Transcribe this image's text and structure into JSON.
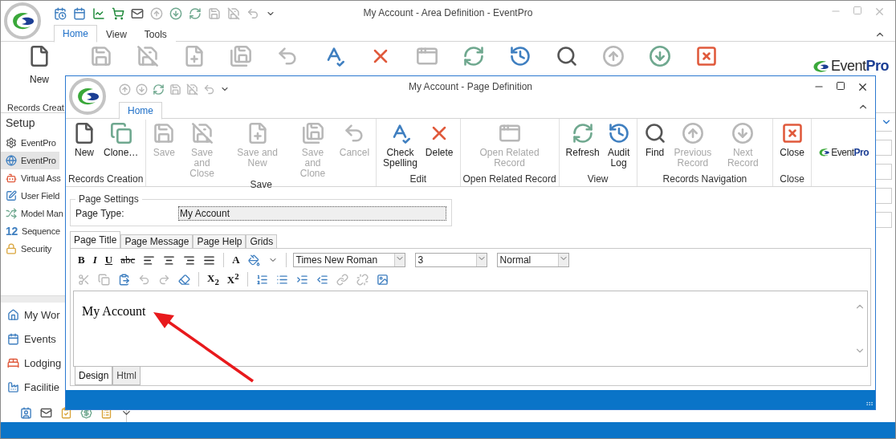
{
  "main_window": {
    "title": "My Account - Area Definition - EventPro",
    "quick_access": [
      {
        "kind": "schedule",
        "disabled": false
      },
      {
        "kind": "calendar",
        "disabled": false
      },
      {
        "kind": "chart",
        "disabled": false
      },
      {
        "kind": "cart",
        "disabled": false
      },
      {
        "kind": "mail",
        "disabled": false
      },
      {
        "kind": "up",
        "disabled": true
      },
      {
        "kind": "down",
        "disabled": false
      },
      {
        "kind": "refresh",
        "disabled": false
      },
      {
        "kind": "save",
        "disabled": true
      },
      {
        "kind": "saveclose",
        "disabled": true
      },
      {
        "kind": "undo",
        "disabled": true
      },
      {
        "kind": "more",
        "disabled": false
      }
    ],
    "tabs": [
      {
        "label": "Home",
        "selected": true
      },
      {
        "label": "View",
        "selected": false
      },
      {
        "label": "Tools",
        "selected": false
      }
    ],
    "ribbon_buttons": [
      {
        "kind": "new",
        "label": "New",
        "disabled": false
      },
      {
        "kind": "save",
        "disabled": true
      },
      {
        "kind": "saveclose",
        "disabled": true
      },
      {
        "kind": "savenew",
        "disabled": true
      },
      {
        "kind": "saveclone",
        "disabled": true
      },
      {
        "kind": "undo",
        "disabled": true
      },
      {
        "kind": "spell",
        "disabled": false
      },
      {
        "kind": "delete",
        "disabled": false
      },
      {
        "kind": "window",
        "disabled": true
      },
      {
        "kind": "refresh",
        "disabled": false
      },
      {
        "kind": "audit",
        "disabled": false
      },
      {
        "kind": "find",
        "disabled": false
      },
      {
        "kind": "up",
        "disabled": true
      },
      {
        "kind": "down",
        "disabled": false
      },
      {
        "kind": "close",
        "disabled": false
      }
    ],
    "group_label": "Records Creat",
    "logo": {
      "main": "Event",
      "accent": "Pro"
    },
    "nav": {
      "header": "Setup",
      "items": [
        {
          "label": "EventPro",
          "selected": false
        },
        {
          "label": "EventPro",
          "selected": true
        },
        {
          "label": "Virtual Ass",
          "selected": false
        },
        {
          "label": "User Field",
          "selected": false
        },
        {
          "label": "Model Man",
          "selected": false
        },
        {
          "glyph": "12",
          "label": "Sequence",
          "selected": false
        },
        {
          "label": "Security",
          "selected": false
        }
      ]
    },
    "modules": [
      {
        "label": "My Wor"
      },
      {
        "label": "Events"
      },
      {
        "label": "Lodging"
      },
      {
        "label": "Facilitie"
      }
    ]
  },
  "dialog": {
    "title": "My Account - Page Definition",
    "quick_access": [
      {
        "kind": "up",
        "disabled": true
      },
      {
        "kind": "down",
        "disabled": true
      },
      {
        "kind": "refresh",
        "disabled": false
      },
      {
        "kind": "save",
        "disabled": true
      },
      {
        "kind": "saveclose",
        "disabled": true
      },
      {
        "kind": "undo",
        "disabled": true
      },
      {
        "kind": "more",
        "disabled": false
      }
    ],
    "tabs": [
      {
        "label": "Home",
        "selected": true
      }
    ],
    "groups": [
      {
        "label": "Records Creation",
        "buttons": [
          {
            "kind": "new",
            "label": "New",
            "disabled": false
          },
          {
            "kind": "clone",
            "label": "Clone…",
            "disabled": false
          }
        ]
      },
      {
        "label": "Save",
        "buttons": [
          {
            "kind": "save",
            "label": "Save",
            "disabled": true
          },
          {
            "kind": "saveclose",
            "label": "Save and\nClose",
            "disabled": true
          },
          {
            "kind": "savenew",
            "label": "Save and New",
            "disabled": true
          },
          {
            "kind": "saveclone",
            "label": "Save and\nClone",
            "disabled": true
          },
          {
            "kind": "undo",
            "label": "Cancel",
            "disabled": true
          }
        ]
      },
      {
        "label": "Edit",
        "buttons": [
          {
            "kind": "spell",
            "label": "Check\nSpelling",
            "disabled": false
          },
          {
            "kind": "delete",
            "label": "Delete",
            "disabled": false
          }
        ]
      },
      {
        "label": "Open Related Record",
        "buttons": [
          {
            "kind": "window",
            "label": "Open Related\nRecord",
            "disabled": true
          }
        ]
      },
      {
        "label": "View",
        "buttons": [
          {
            "kind": "refresh",
            "label": "Refresh",
            "disabled": false
          },
          {
            "kind": "audit",
            "label": "Audit\nLog",
            "disabled": false
          }
        ]
      },
      {
        "label": "Records Navigation",
        "buttons": [
          {
            "kind": "find",
            "label": "Find",
            "disabled": false
          },
          {
            "kind": "up",
            "label": "Previous\nRecord",
            "disabled": true
          },
          {
            "kind": "down",
            "label": "Next Record",
            "disabled": true
          }
        ]
      },
      {
        "label": "Close",
        "buttons": [
          {
            "kind": "close",
            "label": "Close",
            "disabled": false
          }
        ]
      }
    ],
    "logo": {
      "main": "Event",
      "accent": "Pro"
    },
    "page_settings": {
      "legend": "Page Settings",
      "label": "Page Type:",
      "value": "My Account"
    },
    "editor_tabs": [
      {
        "label": "Page Title",
        "selected": true
      },
      {
        "label": "Page Message",
        "selected": false
      },
      {
        "label": "Page Help",
        "selected": false
      },
      {
        "label": "Grids",
        "selected": false
      }
    ],
    "format_text_buttons": [
      {
        "text": "B",
        "kind": "bold"
      },
      {
        "text": "I",
        "kind": "italic"
      },
      {
        "text": "U",
        "kind": "underline"
      },
      {
        "text": "abc",
        "kind": "strike"
      }
    ],
    "color_button": "A",
    "dropdowns": [
      {
        "value": "Times New Roman"
      },
      {
        "value": "3"
      },
      {
        "value": "Normal"
      }
    ],
    "toolbar_row2": [
      {
        "kind": "cut",
        "disabled": true
      },
      {
        "kind": "copy",
        "disabled": true
      },
      {
        "kind": "paste",
        "disabled": false
      },
      {
        "kind": "undo",
        "disabled": true
      },
      {
        "kind": "redo",
        "disabled": true
      },
      {
        "kind": "eraser",
        "disabled": false
      }
    ],
    "script_buttons": [
      {
        "text": "X$_{2}$"
      },
      {
        "text": "X$^{2}$"
      }
    ],
    "toolbar_row2_tail": [
      {
        "kind": "numbered",
        "disabled": false
      },
      {
        "kind": "bullets",
        "disabled": false
      },
      {
        "kind": "indent",
        "disabled": false
      },
      {
        "kind": "outdent",
        "disabled": false
      },
      {
        "kind": "link",
        "disabled": true
      },
      {
        "kind": "unlink",
        "disabled": true
      },
      {
        "kind": "image",
        "disabled": false
      }
    ],
    "content": "My Account",
    "view_tabs": [
      {
        "label": "Design",
        "selected": true
      },
      {
        "label": "Html",
        "selected": false
      }
    ]
  }
}
